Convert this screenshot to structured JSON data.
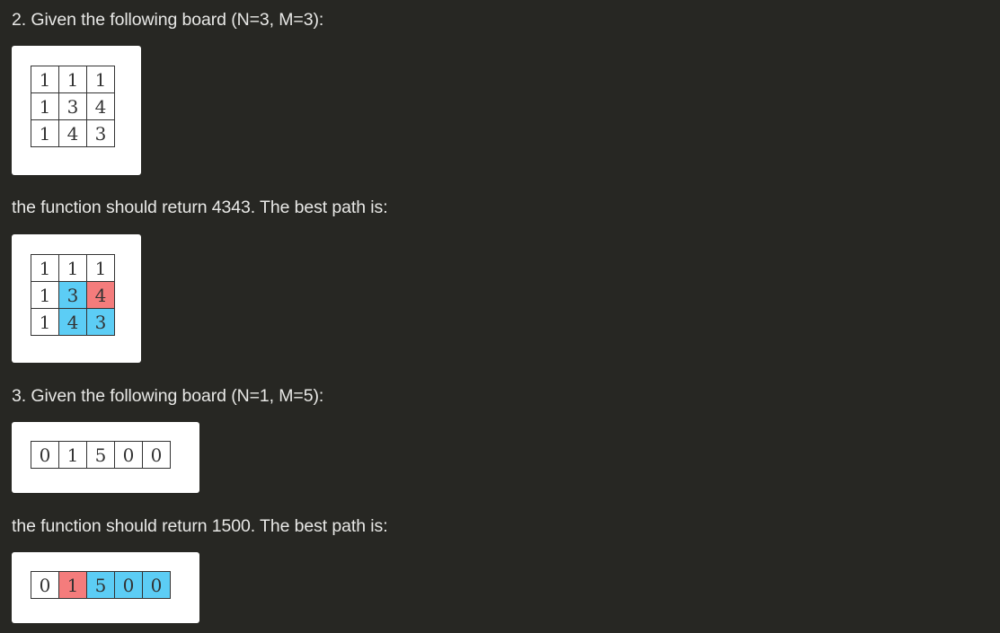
{
  "examples": [
    {
      "heading": "2. Given the following board (N=3, M=3):",
      "board": [
        [
          "1",
          "1",
          "1"
        ],
        [
          "1",
          "3",
          "4"
        ],
        [
          "1",
          "4",
          "3"
        ]
      ],
      "result_text": "the function should return 4343. The best path is:",
      "path_board": [
        [
          {
            "v": "1",
            "h": ""
          },
          {
            "v": "1",
            "h": ""
          },
          {
            "v": "1",
            "h": ""
          }
        ],
        [
          {
            "v": "1",
            "h": ""
          },
          {
            "v": "3",
            "h": "path"
          },
          {
            "v": "4",
            "h": "start"
          }
        ],
        [
          {
            "v": "1",
            "h": ""
          },
          {
            "v": "4",
            "h": "path"
          },
          {
            "v": "3",
            "h": "path"
          }
        ]
      ]
    },
    {
      "heading": "3. Given the following board (N=1, M=5):",
      "board": [
        [
          "0",
          "1",
          "5",
          "0",
          "0"
        ]
      ],
      "result_text": "the function should return 1500. The best path is:",
      "path_board": [
        [
          {
            "v": "0",
            "h": ""
          },
          {
            "v": "1",
            "h": "start"
          },
          {
            "v": "5",
            "h": "path"
          },
          {
            "v": "0",
            "h": "path"
          },
          {
            "v": "0",
            "h": "path"
          }
        ]
      ]
    }
  ],
  "colors": {
    "background": "#272723",
    "text": "#e8e8e6",
    "path_highlight": "#5ccdf5",
    "start_highlight": "#f47c7c"
  }
}
